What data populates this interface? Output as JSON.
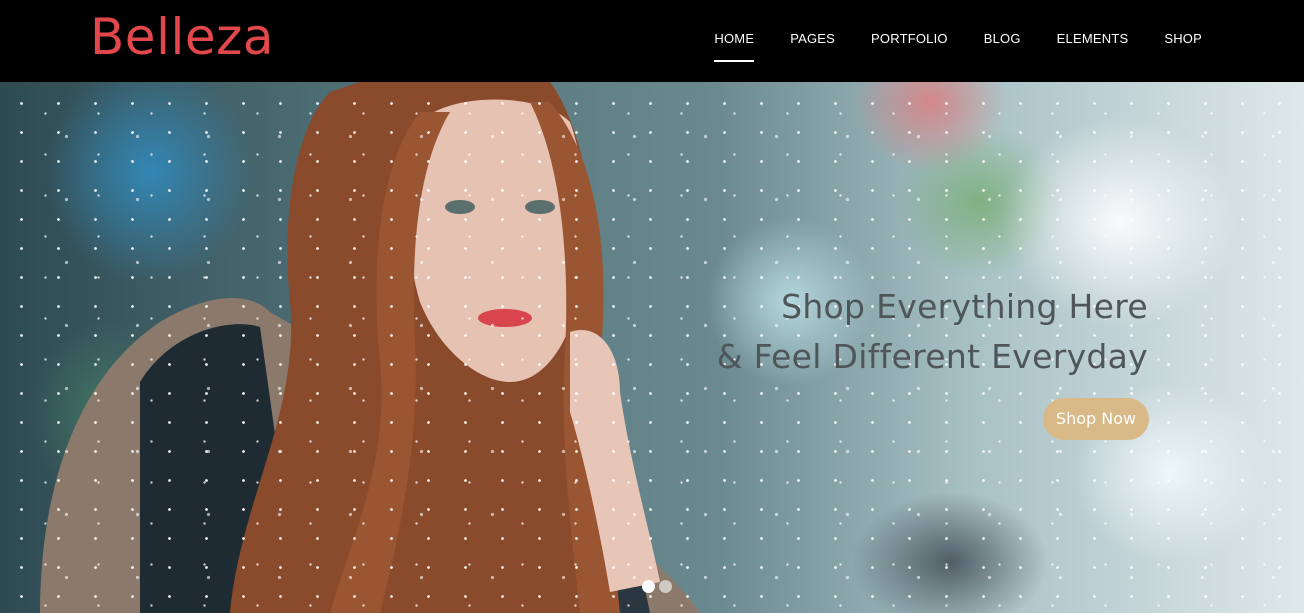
{
  "header": {
    "logo": "Belleza",
    "nav": [
      {
        "label": "HOME",
        "active": true
      },
      {
        "label": "PAGES",
        "active": false
      },
      {
        "label": "PORTFOLIO",
        "active": false
      },
      {
        "label": "BLOG",
        "active": false
      },
      {
        "label": "ELEMENTS",
        "active": false
      },
      {
        "label": "SHOP",
        "active": false
      }
    ]
  },
  "hero": {
    "headline_line1": "Shop Everything Here",
    "headline_line2": "& Feel Different Everyday",
    "cta_label": "Shop Now",
    "slides": 2,
    "active_slide": 1
  },
  "colors": {
    "logo": "#e2474b",
    "header_bg": "#000000",
    "cta_bg": "#d8b987",
    "headline": "#4f5659"
  }
}
